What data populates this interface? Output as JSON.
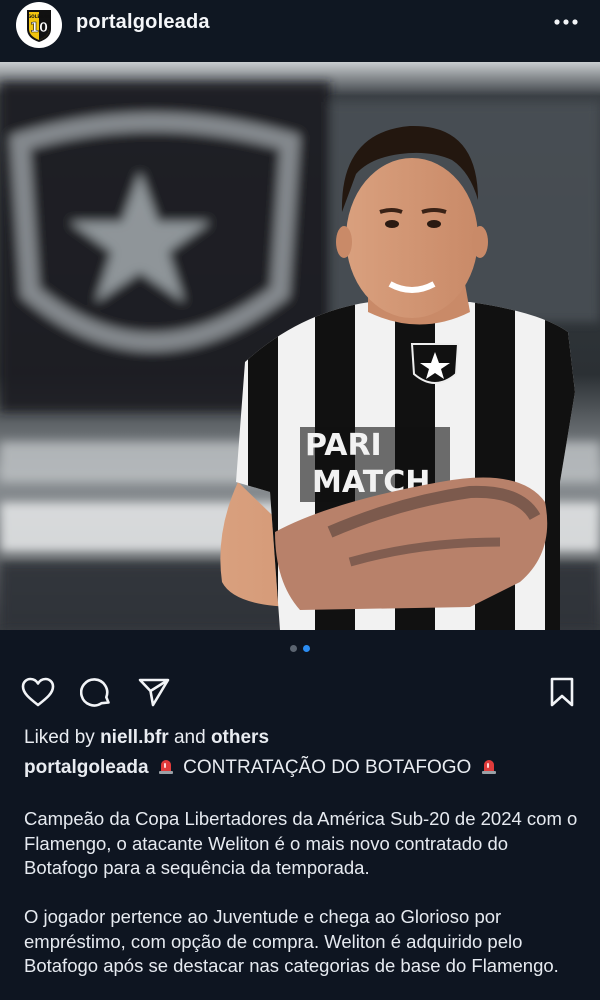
{
  "header": {
    "username": "portalgoleada",
    "avatar_text": "GOLEADA",
    "avatar_number": "10"
  },
  "post": {
    "jersey_sponsor_line1": "PARI",
    "jersey_sponsor_line2": "MATCH",
    "carousel": {
      "count": 2,
      "active_index": 1
    }
  },
  "likes": {
    "prefix": "Liked by",
    "user": "niell.bfr",
    "middle": "and",
    "others": "others"
  },
  "caption": {
    "username": "portalgoleada",
    "headline": "CONTRATAÇÃO DO BOTAFOGO",
    "paragraph1": "Campeão da Copa Libertadores da América Sub-20 de 2024 com o Flamengo, o atacante Weliton é o mais novo contratado do Botafogo para a sequência da temporada.",
    "paragraph2": "O jogador pertence ao Juventude e chega ao Glorioso por empréstimo, com opção de compra. Weliton é adquirido pelo Botafogo após se destacar nas categorias de base do Flamengo."
  },
  "icons": {
    "like": "heart-icon",
    "comment": "comment-icon",
    "share": "send-icon",
    "save": "bookmark-icon",
    "more": "more-options-icon",
    "emoji": "rotating-light-icon"
  },
  "colors": {
    "background": "#0e1521",
    "active_dot": "#2b8cf2",
    "siren": "#e03b3b"
  }
}
